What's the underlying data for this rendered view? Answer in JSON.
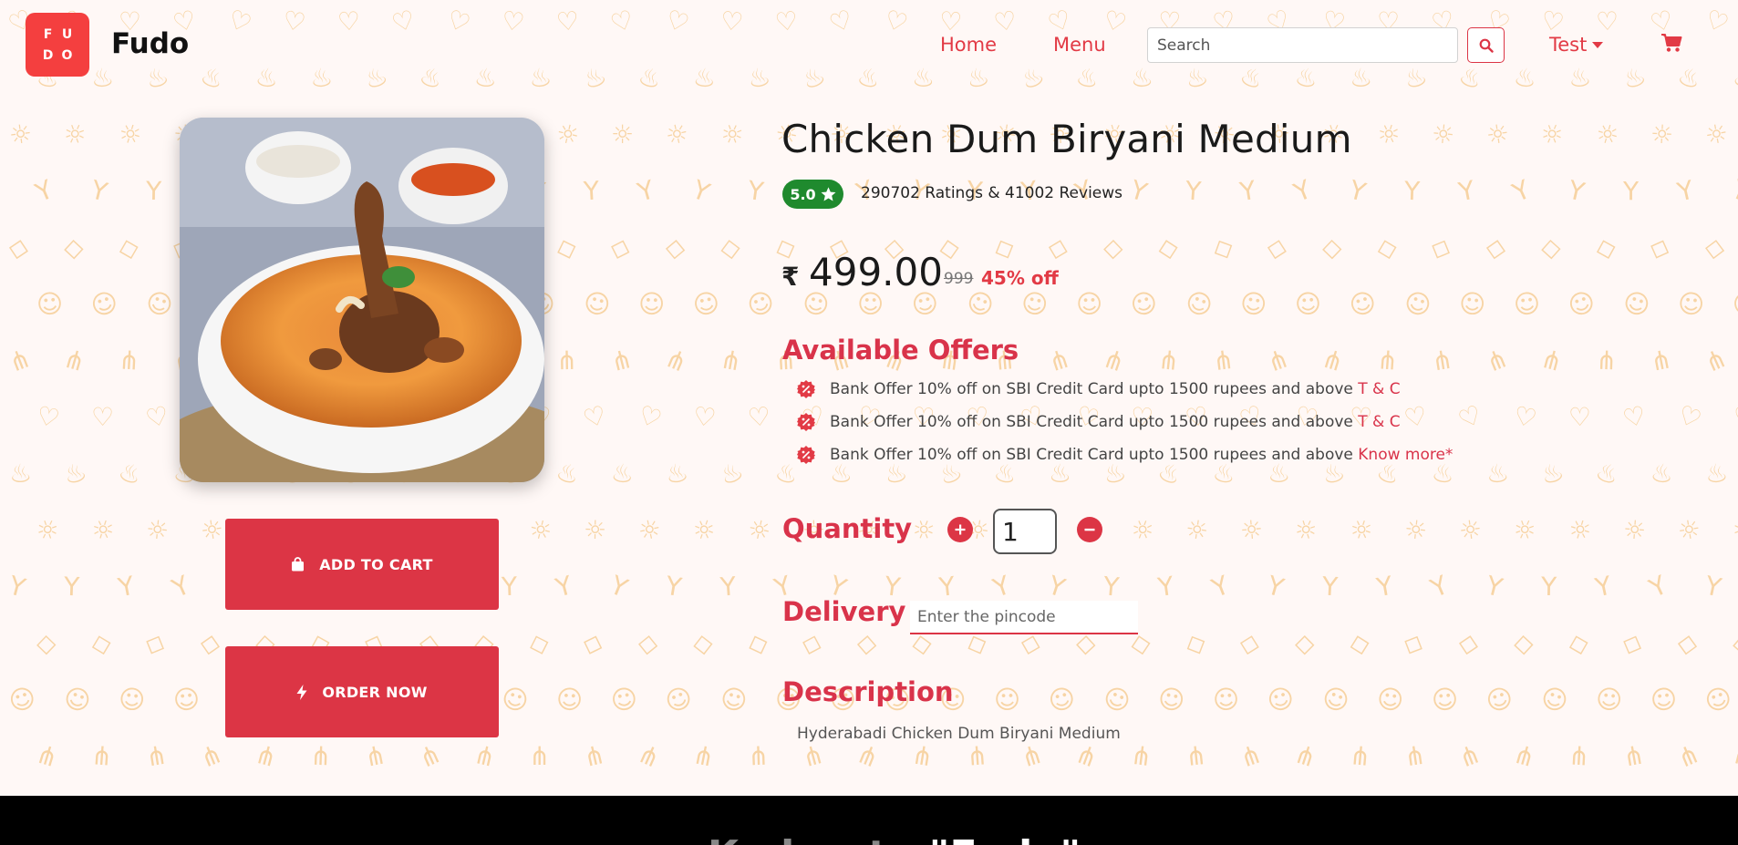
{
  "brand": {
    "logo_letters": [
      "F",
      "U",
      "D",
      "O"
    ],
    "name": "Fudo"
  },
  "nav": {
    "home": "Home",
    "menu": "Menu",
    "search_placeholder": "Search",
    "user": "Test"
  },
  "product": {
    "title": "Chicken Dum Biryani Medium",
    "rating": "5.0",
    "ratings_text": "290702 Ratings & 41002 Reviews",
    "currency": "₹",
    "price": "499.00",
    "old_price": "999",
    "discount": "45% off"
  },
  "actions": {
    "add_to_cart": "ADD TO CART",
    "order_now": "ORDER NOW"
  },
  "offers": {
    "heading": "Available Offers",
    "items": [
      {
        "text": "Bank Offer 10% off on SBI Credit Card upto 1500 rupees and above",
        "link": "T & C"
      },
      {
        "text": "Bank Offer 10% off on SBI Credit Card upto 1500 rupees and above",
        "link": "T & C"
      },
      {
        "text": "Bank Offer 10% off on SBI Credit Card upto 1500 rupees and above",
        "link": "Know more*"
      }
    ]
  },
  "quantity": {
    "heading": "Quantity",
    "value": "1"
  },
  "delivery": {
    "heading": "Delivery",
    "placeholder": "Enter the pincode"
  },
  "description": {
    "heading": "Description",
    "text": "Hyderabadi Chicken Dum Biryani Medium"
  },
  "footer": {
    "text_prefix": "Kadarate",
    "text_highlight": "\"Fudo\""
  },
  "colors": {
    "accent": "#dc3545",
    "accent_text": "#d9334a",
    "rating_green": "#1f8a2e",
    "logo_red": "#f43f3f",
    "background": "#fff8f6",
    "pattern": "#f5c98a"
  },
  "icons": {
    "search": "search-icon",
    "cart": "cart-icon",
    "bag": "shopping-bag-icon",
    "bolt": "bolt-icon",
    "star": "star-icon",
    "offer": "discount-badge-icon",
    "plus": "plus-circle-icon",
    "minus": "minus-circle-icon"
  }
}
